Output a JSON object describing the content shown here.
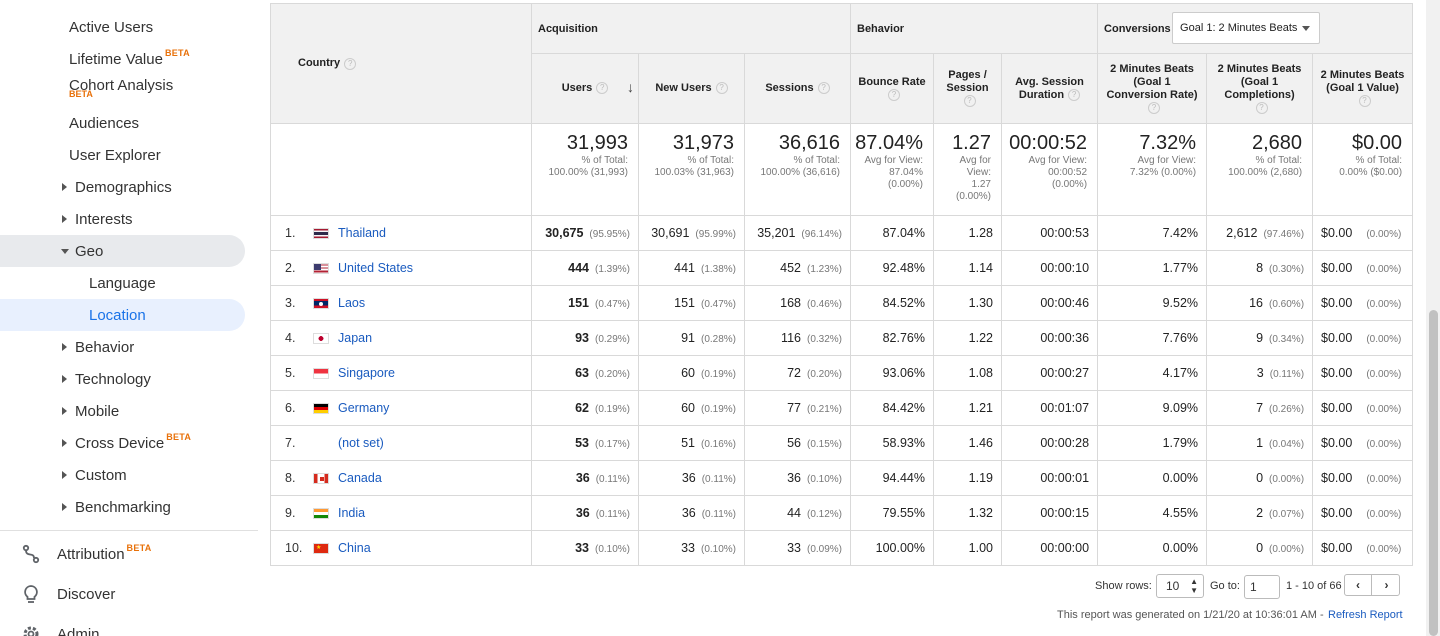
{
  "sidebar": {
    "items": [
      {
        "label": "Active Users"
      },
      {
        "label": "Lifetime Value",
        "badge": "BETA"
      },
      {
        "label": "Cohort Analysis",
        "badge": "BETA"
      },
      {
        "label": "Audiences"
      },
      {
        "label": "User Explorer"
      },
      {
        "label": "Demographics"
      },
      {
        "label": "Interests"
      },
      {
        "label": "Geo"
      },
      {
        "label": "Language"
      },
      {
        "label": "Location"
      },
      {
        "label": "Behavior"
      },
      {
        "label": "Technology"
      },
      {
        "label": "Mobile"
      },
      {
        "label": "Cross Device",
        "badge": "BETA"
      },
      {
        "label": "Custom"
      },
      {
        "label": "Benchmarking"
      }
    ],
    "top_items": [
      {
        "label": "Attribution",
        "badge": "BETA",
        "icon": "attribution-icon"
      },
      {
        "label": "Discover",
        "icon": "lightbulb-icon"
      },
      {
        "label": "Admin",
        "icon": "gear-icon"
      }
    ]
  },
  "table": {
    "country_header": "Country",
    "groups": {
      "acquisition": "Acquisition",
      "behavior": "Behavior",
      "conversions": "Conversions"
    },
    "goal_select": "Goal 1: 2 Minutes Beats",
    "columns": {
      "users": "Users",
      "new_users": "New Users",
      "sessions": "Sessions",
      "bounce_rate": "Bounce Rate",
      "pages_session": "Pages / Session",
      "avg_duration": "Avg. Session Duration",
      "goal_rate": "2 Minutes Beats (Goal 1 Conversion Rate)",
      "goal_completions": "2 Minutes Beats (Goal 1 Completions)",
      "goal_value": "2 Minutes Beats (Goal 1 Value)"
    },
    "totals": {
      "users": {
        "value": "31,993",
        "l1": "% of Total:",
        "l2": "100.00% (31,993)"
      },
      "new_users": {
        "value": "31,973",
        "l1": "% of Total:",
        "l2": "100.03% (31,963)"
      },
      "sessions": {
        "value": "36,616",
        "l1": "% of Total:",
        "l2": "100.00% (36,616)"
      },
      "bounce_rate": {
        "value": "87.04%",
        "l1": "Avg for View:",
        "l2": "87.04%",
        "l3": "(0.00%)"
      },
      "pages_session": {
        "value": "1.27",
        "l1": "Avg for",
        "l2": "View:",
        "l3": "1.27",
        "l4": "(0.00%)"
      },
      "avg_duration": {
        "value": "00:00:52",
        "l1": "Avg for View:",
        "l2": "00:00:52",
        "l3": "(0.00%)"
      },
      "goal_rate": {
        "value": "7.32%",
        "l1": "Avg for View:",
        "l2": "7.32% (0.00%)"
      },
      "goal_completions": {
        "value": "2,680",
        "l1": "% of Total:",
        "l2": "100.00% (2,680)"
      },
      "goal_value": {
        "value": "$0.00",
        "l1": "% of Total:",
        "l2": "0.00% ($0.00)"
      }
    },
    "rows": [
      {
        "idx": "1.",
        "country": "Thailand",
        "flag": "thailand",
        "users": "30,675",
        "users_pct": "(95.95%)",
        "new_users": "30,691",
        "new_pct": "(95.99%)",
        "sessions": "35,201",
        "sess_pct": "(96.14%)",
        "bounce": "87.04%",
        "pages": "1.28",
        "duration": "00:00:53",
        "rate": "7.42%",
        "comp": "2,612",
        "comp_pct": "(97.46%)",
        "value": "$0.00",
        "value_pct": "(0.00%)"
      },
      {
        "idx": "2.",
        "country": "United States",
        "flag": "us",
        "users": "444",
        "users_pct": "(1.39%)",
        "new_users": "441",
        "new_pct": "(1.38%)",
        "sessions": "452",
        "sess_pct": "(1.23%)",
        "bounce": "92.48%",
        "pages": "1.14",
        "duration": "00:00:10",
        "rate": "1.77%",
        "comp": "8",
        "comp_pct": "(0.30%)",
        "value": "$0.00",
        "value_pct": "(0.00%)"
      },
      {
        "idx": "3.",
        "country": "Laos",
        "flag": "laos",
        "users": "151",
        "users_pct": "(0.47%)",
        "new_users": "151",
        "new_pct": "(0.47%)",
        "sessions": "168",
        "sess_pct": "(0.46%)",
        "bounce": "84.52%",
        "pages": "1.30",
        "duration": "00:00:46",
        "rate": "9.52%",
        "comp": "16",
        "comp_pct": "(0.60%)",
        "value": "$0.00",
        "value_pct": "(0.00%)"
      },
      {
        "idx": "4.",
        "country": "Japan",
        "flag": "japan",
        "users": "93",
        "users_pct": "(0.29%)",
        "new_users": "91",
        "new_pct": "(0.28%)",
        "sessions": "116",
        "sess_pct": "(0.32%)",
        "bounce": "82.76%",
        "pages": "1.22",
        "duration": "00:00:36",
        "rate": "7.76%",
        "comp": "9",
        "comp_pct": "(0.34%)",
        "value": "$0.00",
        "value_pct": "(0.00%)"
      },
      {
        "idx": "5.",
        "country": "Singapore",
        "flag": "singapore",
        "users": "63",
        "users_pct": "(0.20%)",
        "new_users": "60",
        "new_pct": "(0.19%)",
        "sessions": "72",
        "sess_pct": "(0.20%)",
        "bounce": "93.06%",
        "pages": "1.08",
        "duration": "00:00:27",
        "rate": "4.17%",
        "comp": "3",
        "comp_pct": "(0.11%)",
        "value": "$0.00",
        "value_pct": "(0.00%)"
      },
      {
        "idx": "6.",
        "country": "Germany",
        "flag": "germany",
        "users": "62",
        "users_pct": "(0.19%)",
        "new_users": "60",
        "new_pct": "(0.19%)",
        "sessions": "77",
        "sess_pct": "(0.21%)",
        "bounce": "84.42%",
        "pages": "1.21",
        "duration": "00:01:07",
        "rate": "9.09%",
        "comp": "7",
        "comp_pct": "(0.26%)",
        "value": "$0.00",
        "value_pct": "(0.00%)"
      },
      {
        "idx": "7.",
        "country": "(not set)",
        "flag": "",
        "users": "53",
        "users_pct": "(0.17%)",
        "new_users": "51",
        "new_pct": "(0.16%)",
        "sessions": "56",
        "sess_pct": "(0.15%)",
        "bounce": "58.93%",
        "pages": "1.46",
        "duration": "00:00:28",
        "rate": "1.79%",
        "comp": "1",
        "comp_pct": "(0.04%)",
        "value": "$0.00",
        "value_pct": "(0.00%)"
      },
      {
        "idx": "8.",
        "country": "Canada",
        "flag": "canada",
        "users": "36",
        "users_pct": "(0.11%)",
        "new_users": "36",
        "new_pct": "(0.11%)",
        "sessions": "36",
        "sess_pct": "(0.10%)",
        "bounce": "94.44%",
        "pages": "1.19",
        "duration": "00:00:01",
        "rate": "0.00%",
        "comp": "0",
        "comp_pct": "(0.00%)",
        "value": "$0.00",
        "value_pct": "(0.00%)"
      },
      {
        "idx": "9.",
        "country": "India",
        "flag": "india",
        "users": "36",
        "users_pct": "(0.11%)",
        "new_users": "36",
        "new_pct": "(0.11%)",
        "sessions": "44",
        "sess_pct": "(0.12%)",
        "bounce": "79.55%",
        "pages": "1.32",
        "duration": "00:00:15",
        "rate": "4.55%",
        "comp": "2",
        "comp_pct": "(0.07%)",
        "value": "$0.00",
        "value_pct": "(0.00%)"
      },
      {
        "idx": "10.",
        "country": "China",
        "flag": "china",
        "users": "33",
        "users_pct": "(0.10%)",
        "new_users": "33",
        "new_pct": "(0.10%)",
        "sessions": "33",
        "sess_pct": "(0.09%)",
        "bounce": "100.00%",
        "pages": "1.00",
        "duration": "00:00:00",
        "rate": "0.00%",
        "comp": "0",
        "comp_pct": "(0.00%)",
        "value": "$0.00",
        "value_pct": "(0.00%)"
      }
    ]
  },
  "footer": {
    "show_rows_label": "Show rows:",
    "show_rows_value": "10",
    "goto_label": "Go to:",
    "goto_value": "1",
    "range": "1 - 10 of 66",
    "generated": "This report was generated on 1/21/20 at 10:36:01 AM - ",
    "refresh": "Refresh Report"
  }
}
